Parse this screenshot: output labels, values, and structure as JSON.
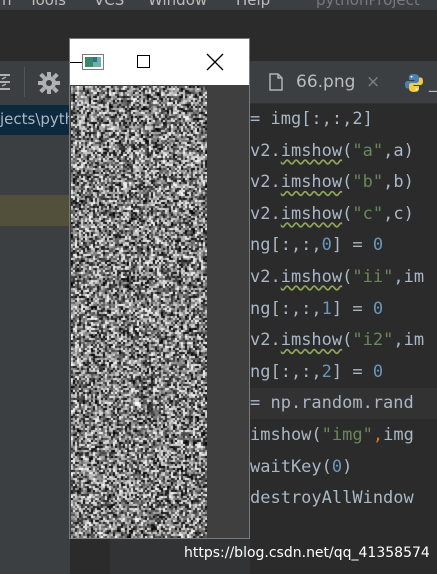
{
  "menu": {
    "items": [
      "n",
      "Tools",
      "VCS",
      "Window",
      "Help"
    ],
    "project_title": "pythonProject"
  },
  "project_panel": {
    "path_label": "jects\\pyth"
  },
  "editor": {
    "tabs": [
      {
        "label": "66.png",
        "close": "×"
      },
      {
        "label": "",
        "icon": "python-file-icon"
      }
    ],
    "lines": [
      {
        "segments": [
          {
            "t": "= img[:,:,2]"
          }
        ]
      },
      {
        "segments": [
          {
            "t": "v2."
          },
          {
            "t": "imshow",
            "cls": "warn"
          },
          {
            "t": "("
          },
          {
            "t": "\"a\"",
            "cls": "str"
          },
          {
            "t": ",a)"
          }
        ]
      },
      {
        "segments": [
          {
            "t": "v2."
          },
          {
            "t": "imshow",
            "cls": "warn"
          },
          {
            "t": "("
          },
          {
            "t": "\"b\"",
            "cls": "str"
          },
          {
            "t": ",b)"
          }
        ]
      },
      {
        "segments": [
          {
            "t": "v2."
          },
          {
            "t": "imshow",
            "cls": "warn"
          },
          {
            "t": "("
          },
          {
            "t": "\"c\"",
            "cls": "str"
          },
          {
            "t": ",c)"
          }
        ]
      },
      {
        "segments": [
          {
            "t": "ng[:,:,"
          },
          {
            "t": "0",
            "cls": "num"
          },
          {
            "t": "] = "
          },
          {
            "t": "0",
            "cls": "num"
          }
        ]
      },
      {
        "segments": [
          {
            "t": "v2."
          },
          {
            "t": "imshow",
            "cls": "warn"
          },
          {
            "t": "("
          },
          {
            "t": "\"ii\"",
            "cls": "str"
          },
          {
            "t": ",im"
          }
        ]
      },
      {
        "segments": [
          {
            "t": "ng[:,:,"
          },
          {
            "t": "1",
            "cls": "num"
          },
          {
            "t": "] = "
          },
          {
            "t": "0",
            "cls": "num"
          }
        ]
      },
      {
        "segments": [
          {
            "t": "v2."
          },
          {
            "t": "imshow",
            "cls": "warn"
          },
          {
            "t": "("
          },
          {
            "t": "\"i2\"",
            "cls": "str"
          },
          {
            "t": ",im"
          }
        ]
      },
      {
        "segments": [
          {
            "t": "ng[:,:,"
          },
          {
            "t": "2",
            "cls": "num"
          },
          {
            "t": "] = "
          },
          {
            "t": "0",
            "cls": "num"
          }
        ]
      },
      {
        "segments": [
          {
            "t": "= np.random.rand"
          }
        ],
        "active": true
      },
      {
        "segments": [
          {
            "t": "imshow("
          },
          {
            "t": "\"img\"",
            "cls": "str"
          },
          {
            "t": ",",
            "cls": "hint"
          },
          {
            "t": "img"
          }
        ]
      },
      {
        "segments": [
          {
            "t": "waitKey("
          },
          {
            "t": "0",
            "cls": "num"
          },
          {
            "t": ")"
          }
        ]
      },
      {
        "segments": [
          {
            "t": "destroyAllWindow"
          }
        ]
      }
    ]
  },
  "cv_window": {
    "title_icon": "opencv-window-icon",
    "buttons": [
      "minimize-icon",
      "maximize-icon",
      "close-icon"
    ]
  },
  "watermark": "https://blog.csdn.net/qq_41358574",
  "colors": {
    "editor_bg": "#2b2b2b",
    "panel_bg": "#3c3f41",
    "gutter_bg": "#313335",
    "string": "#6a8759",
    "number": "#6897bb",
    "text": "#a9b7c6",
    "selection": "#0d293e"
  }
}
